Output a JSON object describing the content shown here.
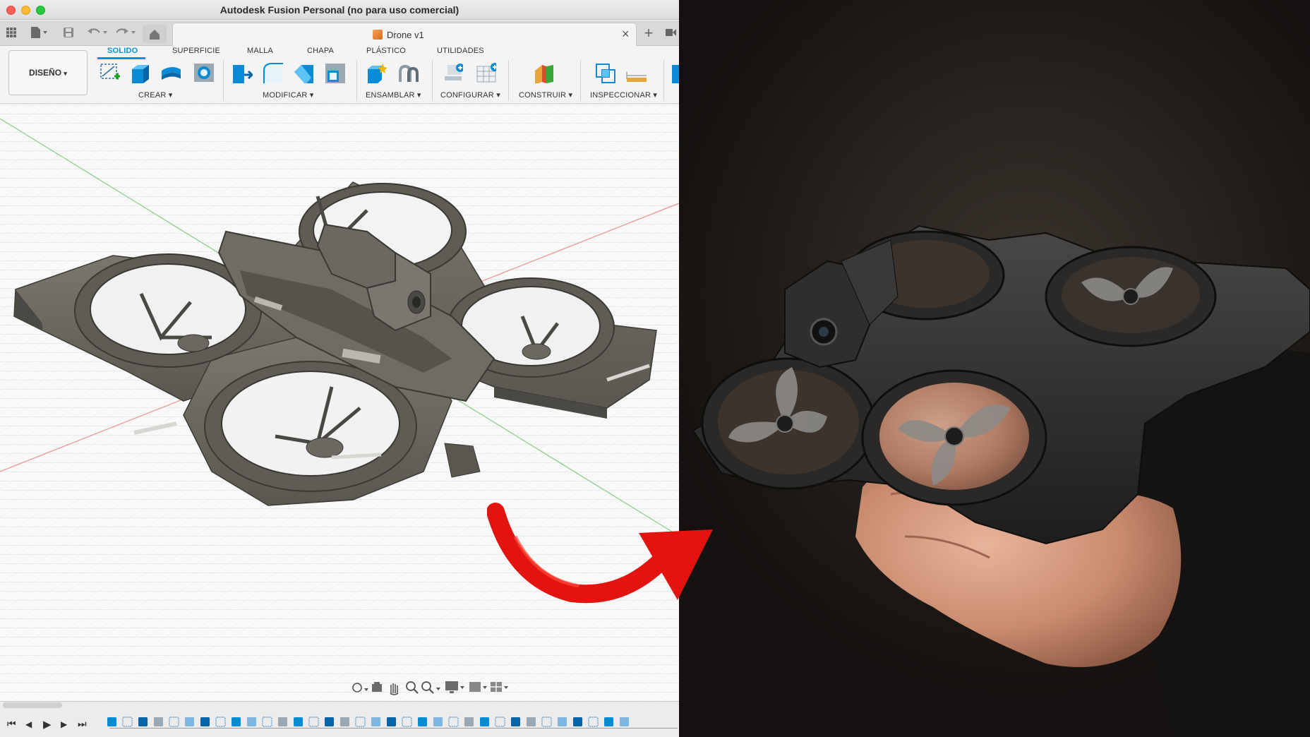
{
  "window": {
    "title": "Autodesk Fusion Personal (no para uso comercial)"
  },
  "document_tab": {
    "name": "Drone v1",
    "close_symbol": "×"
  },
  "workspace_menu": {
    "label": "DISEÑO",
    "caret": "▾"
  },
  "ribbon_tabs": [
    {
      "label": "SOLIDO",
      "active": true
    },
    {
      "label": "SUPERFICIE",
      "active": false
    },
    {
      "label": "MALLA",
      "active": false
    },
    {
      "label": "CHAPA",
      "active": false
    },
    {
      "label": "PLÁSTICO",
      "active": false
    },
    {
      "label": "UTILIDADES",
      "active": false
    }
  ],
  "ribbon_groups": [
    {
      "label": "CREAR ▾",
      "icons": [
        "create-sketch-icon",
        "extrude-icon",
        "revolve-icon",
        "hole-icon"
      ]
    },
    {
      "label": "MODIFICAR ▾",
      "icons": [
        "press-pull-icon",
        "fillet-icon",
        "chamfer-icon",
        "shell-icon"
      ]
    },
    {
      "label": "ENSAMBLAR ▾",
      "icons": [
        "new-component-icon",
        "joint-icon"
      ]
    },
    {
      "label": "CONFIGURAR ▾",
      "icons": [
        "configure-icon",
        "configuration-table-icon"
      ]
    },
    {
      "label": "CONSTRUIR ▾",
      "icons": [
        "offset-plane-icon"
      ]
    },
    {
      "label": "INSPECCIONAR ▾",
      "icons": [
        "interference-icon",
        "measure-icon"
      ]
    }
  ],
  "quick_access": [
    "grid-icon",
    "file-icon",
    "save-icon",
    "undo-icon",
    "redo-icon",
    "home-icon"
  ],
  "navigation_bar": [
    "orbit-icon",
    "look-at-icon",
    "pan-icon",
    "zoom-icon",
    "fit-icon",
    "display-settings-icon",
    "visual-style-icon",
    "viewports-icon"
  ],
  "playback_controls": [
    {
      "name": "go-to-start",
      "glyph": "⏮"
    },
    {
      "name": "step-back",
      "glyph": "◀"
    },
    {
      "name": "play",
      "glyph": "▶"
    },
    {
      "name": "step-forward",
      "glyph": "▶"
    },
    {
      "name": "go-to-end",
      "glyph": "⏭"
    }
  ],
  "timeline_feature_count": 34,
  "colors": {
    "accent": "#0696d7",
    "model_gray": "#6c6961",
    "axis_red": "#e07070",
    "axis_green": "#68c068",
    "arrow_red": "#e3130f",
    "photo_bg": "#2a2420"
  }
}
